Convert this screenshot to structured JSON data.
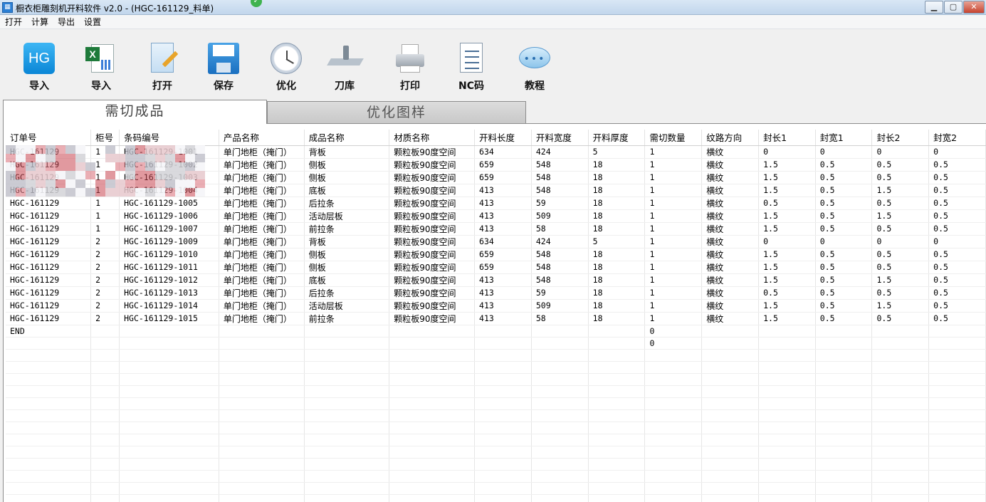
{
  "window": {
    "title": "橱衣柜雕刻机开料软件 v2.0  - (HGC-161129_料单)",
    "minimize": "▁",
    "maximize": "▢",
    "close": "✕"
  },
  "menu": [
    "打开",
    "计算",
    "导出",
    "设置"
  ],
  "toolbar": [
    {
      "label": "导入",
      "icon": "hg-logo-icon",
      "icon_text": "HG"
    },
    {
      "label": "导入",
      "icon": "excel-icon",
      "icon_text": "X"
    },
    {
      "label": "打开",
      "icon": "open-document-icon"
    },
    {
      "label": "保存",
      "icon": "floppy-disk-icon"
    },
    {
      "label": "优化",
      "icon": "clock-icon"
    },
    {
      "label": "刀库",
      "icon": "tool-library-icon"
    },
    {
      "label": "打印",
      "icon": "printer-icon"
    },
    {
      "label": "NC码",
      "icon": "nc-document-icon"
    },
    {
      "label": "教程",
      "icon": "chat-bubble-icon",
      "icon_text": "•••"
    }
  ],
  "tabs": [
    {
      "label": "需切成品",
      "active": true
    },
    {
      "label": "优化图样",
      "active": false
    }
  ],
  "table": {
    "columns": [
      "订单号",
      "柜号",
      "条码编号",
      "产品名称",
      "成品名称",
      "材质名称",
      "开料长度",
      "开料宽度",
      "开料厚度",
      "需切数量",
      "纹路方向",
      "封长1",
      "封宽1",
      "封长2",
      "封宽2"
    ],
    "rows": [
      [
        "HGC-161129",
        "1",
        "HGC-161129-1001",
        "单门地柜（掩门）",
        "背板",
        "颗粒板90度空间",
        "634",
        "424",
        "5",
        "1",
        "横纹",
        "0",
        "0",
        "0",
        "0"
      ],
      [
        "HGC-161129",
        "1",
        "HGC-161129-1002",
        "单门地柜（掩门）",
        "侧板",
        "颗粒板90度空间",
        "659",
        "548",
        "18",
        "1",
        "横纹",
        "1.5",
        "0.5",
        "0.5",
        "0.5"
      ],
      [
        "HGC-161129",
        "1",
        "HGC-161129-1003",
        "单门地柜（掩门）",
        "侧板",
        "颗粒板90度空间",
        "659",
        "548",
        "18",
        "1",
        "横纹",
        "1.5",
        "0.5",
        "0.5",
        "0.5"
      ],
      [
        "HGC-161129",
        "1",
        "HGC-161129-1004",
        "单门地柜（掩门）",
        "底板",
        "颗粒板90度空间",
        "413",
        "548",
        "18",
        "1",
        "横纹",
        "1.5",
        "0.5",
        "1.5",
        "0.5"
      ],
      [
        "HGC-161129",
        "1",
        "HGC-161129-1005",
        "单门地柜（掩门）",
        "后拉条",
        "颗粒板90度空间",
        "413",
        "59",
        "18",
        "1",
        "横纹",
        "0.5",
        "0.5",
        "0.5",
        "0.5"
      ],
      [
        "HGC-161129",
        "1",
        "HGC-161129-1006",
        "单门地柜（掩门）",
        "活动层板",
        "颗粒板90度空间",
        "413",
        "509",
        "18",
        "1",
        "横纹",
        "1.5",
        "0.5",
        "1.5",
        "0.5"
      ],
      [
        "HGC-161129",
        "1",
        "HGC-161129-1007",
        "单门地柜（掩门）",
        "前拉条",
        "颗粒板90度空间",
        "413",
        "58",
        "18",
        "1",
        "横纹",
        "1.5",
        "0.5",
        "0.5",
        "0.5"
      ],
      [
        "HGC-161129",
        "2",
        "HGC-161129-1009",
        "单门地柜（掩门）",
        "背板",
        "颗粒板90度空间",
        "634",
        "424",
        "5",
        "1",
        "横纹",
        "0",
        "0",
        "0",
        "0"
      ],
      [
        "HGC-161129",
        "2",
        "HGC-161129-1010",
        "单门地柜（掩门）",
        "侧板",
        "颗粒板90度空间",
        "659",
        "548",
        "18",
        "1",
        "横纹",
        "1.5",
        "0.5",
        "0.5",
        "0.5"
      ],
      [
        "HGC-161129",
        "2",
        "HGC-161129-1011",
        "单门地柜（掩门）",
        "侧板",
        "颗粒板90度空间",
        "659",
        "548",
        "18",
        "1",
        "横纹",
        "1.5",
        "0.5",
        "0.5",
        "0.5"
      ],
      [
        "HGC-161129",
        "2",
        "HGC-161129-1012",
        "单门地柜（掩门）",
        "底板",
        "颗粒板90度空间",
        "413",
        "548",
        "18",
        "1",
        "横纹",
        "1.5",
        "0.5",
        "1.5",
        "0.5"
      ],
      [
        "HGC-161129",
        "2",
        "HGC-161129-1013",
        "单门地柜（掩门）",
        "后拉条",
        "颗粒板90度空间",
        "413",
        "59",
        "18",
        "1",
        "横纹",
        "0.5",
        "0.5",
        "0.5",
        "0.5"
      ],
      [
        "HGC-161129",
        "2",
        "HGC-161129-1014",
        "单门地柜（掩门）",
        "活动层板",
        "颗粒板90度空间",
        "413",
        "509",
        "18",
        "1",
        "横纹",
        "1.5",
        "0.5",
        "1.5",
        "0.5"
      ],
      [
        "HGC-161129",
        "2",
        "HGC-161129-1015",
        "单门地柜（掩门）",
        "前拉条",
        "颗粒板90度空间",
        "413",
        "58",
        "18",
        "1",
        "横纹",
        "1.5",
        "0.5",
        "0.5",
        "0.5"
      ],
      [
        "END",
        "",
        "",
        "",
        "",
        "",
        "",
        "",
        "",
        "0",
        "",
        "",
        "",
        "",
        ""
      ],
      [
        "",
        "",
        "",
        "",
        "",
        "",
        "",
        "",
        "",
        "0",
        "",
        "",
        "",
        "",
        ""
      ]
    ],
    "empty_rows": 14
  },
  "colors": {
    "accent": "#0a86d6",
    "redact": "#d23a3a"
  }
}
